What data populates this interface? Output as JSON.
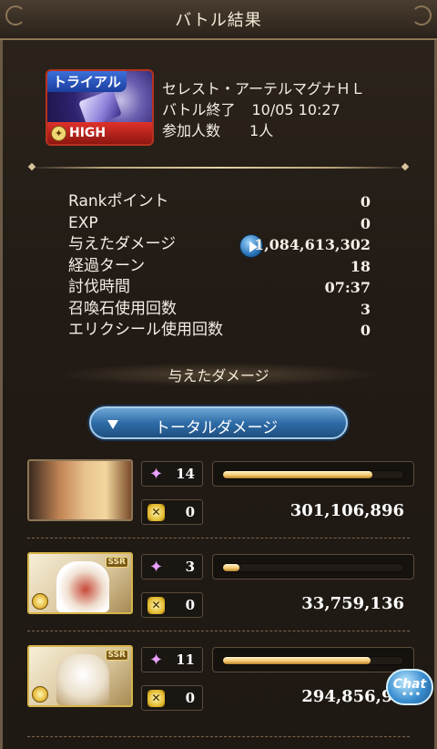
{
  "header": {
    "title": "バトル結果"
  },
  "quest": {
    "badge": "トライアル",
    "level_badge": "HIGH LEVEL",
    "name": "セレスト・アーテルマグナＨＬ",
    "end_label": "バトル終了",
    "end_time": "10/05 10:27",
    "participants_label": "参加人数",
    "participants": "1人"
  },
  "stats": [
    {
      "label": "Rankポイント",
      "value": "0"
    },
    {
      "label": "EXP",
      "value": "0"
    },
    {
      "label": "与えたダメージ",
      "value": "1,084,613,302"
    },
    {
      "label": "経過ターン",
      "value": "18"
    },
    {
      "label": "討伐時間",
      "value": "07:37"
    },
    {
      "label": "召喚石使用回数",
      "value": "3"
    },
    {
      "label": "エリクシール使用回数",
      "value": "0"
    }
  ],
  "damage_section": {
    "heading": "与えたダメージ",
    "dropdown_label": "トータルダメージ"
  },
  "members": [
    {
      "skill_count": "14",
      "ougi_count": "0",
      "damage": "301,106,896",
      "bar_fraction": 0.83
    },
    {
      "skill_count": "3",
      "ougi_count": "0",
      "damage": "33,759,136",
      "bar_fraction": 0.09,
      "badge": "SSR"
    },
    {
      "skill_count": "11",
      "ougi_count": "0",
      "damage": "294,856,96",
      "bar_fraction": 0.82,
      "badge": "SSR"
    }
  ],
  "chat": {
    "label": "Chat",
    "dots": "•••"
  },
  "colors": {
    "accent_blue": "#2f6da8",
    "bar_gold": "#f2c46a",
    "frame": "#6b5a45"
  }
}
